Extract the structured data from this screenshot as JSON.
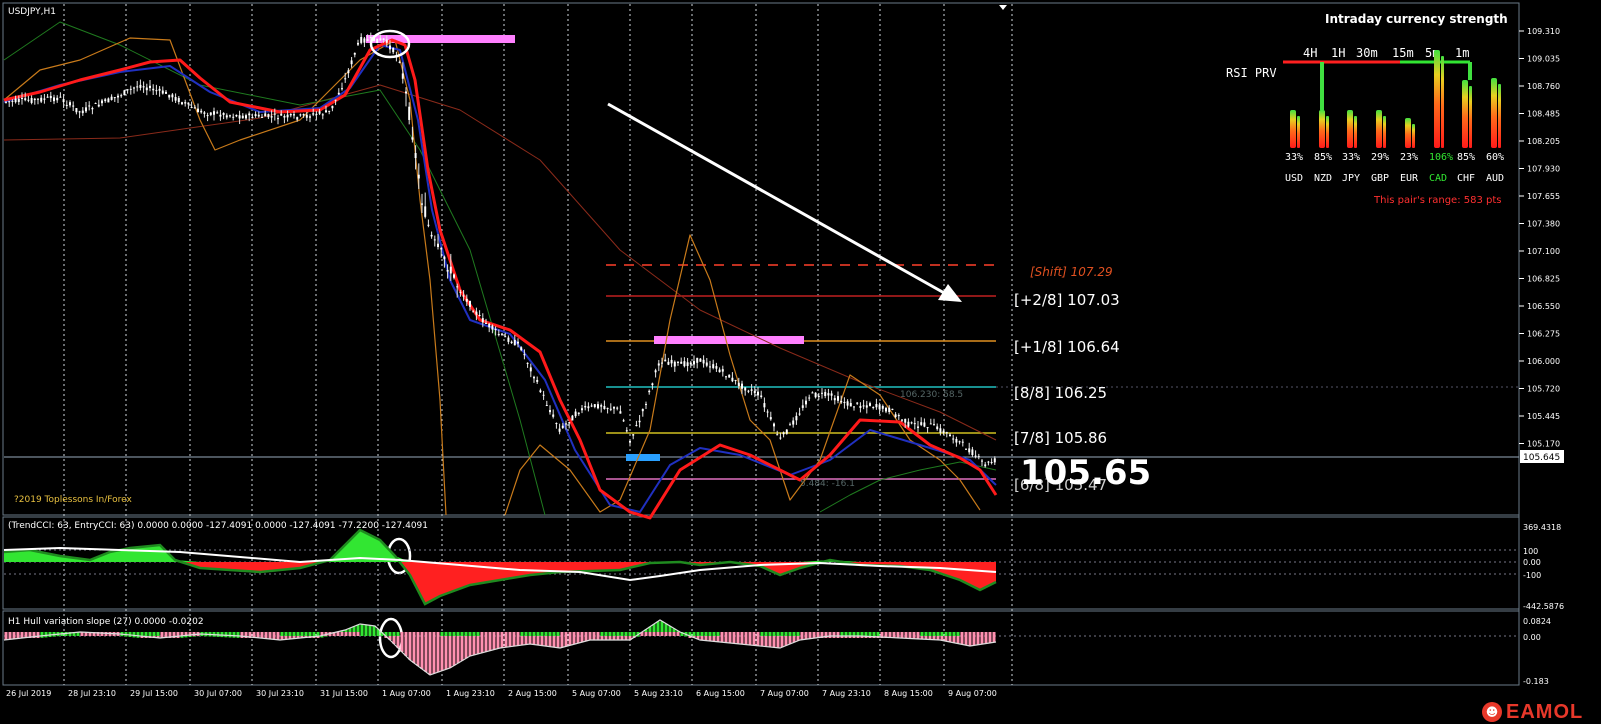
{
  "window": {
    "symbol_label": "USDJPY,H1",
    "copyright": "?2019 Toplessons In/Forex"
  },
  "price_axis": [
    "109.310",
    "109.035",
    "108.760",
    "108.485",
    "108.205",
    "107.930",
    "107.655",
    "107.380",
    "107.100",
    "106.825",
    "106.550",
    "106.275",
    "106.000",
    "105.720",
    "105.445",
    "105.170"
  ],
  "current_price_tag": "105.645",
  "big_price": "105.65",
  "murrey": [
    {
      "label": "[Shift]  107.29",
      "color": "#e05020"
    },
    {
      "label": "[+2/8] 107.03",
      "color": "#ffffff"
    },
    {
      "label": "[+1/8] 106.64",
      "color": "#ffffff"
    },
    {
      "label": "[8/8] 106.25",
      "color": "#ffffff"
    },
    {
      "label": "[7/8] 105.86",
      "color": "#ffffff"
    },
    {
      "label": "[6/8] 105.47",
      "color": "#ffffff"
    }
  ],
  "ghost_labels": {
    "line_8_8": "106.230: 58.5",
    "line_6_8": "5.484: -16.1"
  },
  "strength_panel": {
    "title": "Intraday currency strength",
    "timeframes": [
      "4H",
      "1H",
      "30m",
      "15m",
      "5m",
      "1m"
    ],
    "rsi_label": "RSI PRV",
    "currencies": [
      {
        "code": "USD",
        "pct": "33%",
        "color": "#ffffff"
      },
      {
        "code": "NZD",
        "pct": "85%",
        "color": "#ffffff"
      },
      {
        "code": "JPY",
        "pct": "33%",
        "color": "#ffffff"
      },
      {
        "code": "GBP",
        "pct": "29%",
        "color": "#ffffff"
      },
      {
        "code": "EUR",
        "pct": "23%",
        "color": "#ffffff"
      },
      {
        "code": "CAD",
        "pct": "106%",
        "color": "#32e632"
      },
      {
        "code": "CHF",
        "pct": "85%",
        "color": "#ffffff"
      },
      {
        "code": "AUD",
        "pct": "60%",
        "color": "#ffffff"
      }
    ],
    "range_text": "This pair's range: 583 pts"
  },
  "cci_panel": {
    "header": "(TrendCCI: 63, EntryCCI: 63)  0.0000 0.0000 -127.4091 0.0000 -127.4091 -77.2200 -127.4091",
    "axis": [
      "369.4318",
      "100",
      "0.00",
      "-100",
      "-442.5876"
    ]
  },
  "hull_panel": {
    "header": "H1 Hull variation slope (27) 0.0000 -0.0202",
    "axis": [
      "0.0824",
      "0.00",
      "-0.183"
    ]
  },
  "time_axis": [
    "26 Jul 2019",
    "28 Jul 23:10",
    "29 Jul 15:00",
    "30 Jul 07:00",
    "30 Jul 23:10",
    "31 Jul 15:00",
    "1 Aug 07:00",
    "1 Aug 23:10",
    "2 Aug 15:00",
    "5 Aug 07:00",
    "5 Aug 23:10",
    "6 Aug 15:00",
    "7 Aug 07:00",
    "7 Aug 23:10",
    "8 Aug 15:00",
    "9 Aug 07:00"
  ],
  "logo": {
    "text": "EAMOL"
  },
  "colors": {
    "up": "#32e632",
    "down": "#ff2020",
    "pink": "#ff80ff",
    "blue": "#2aa0ff"
  }
}
